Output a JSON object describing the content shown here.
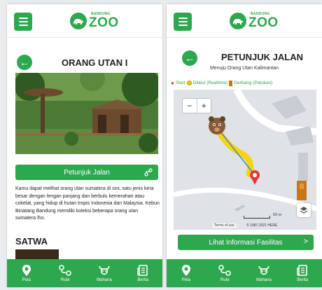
{
  "brand": {
    "small": "BANDUNG",
    "big": "ZOO",
    "green": "#2ea84f"
  },
  "left": {
    "title": "ORANG UTAN I",
    "button_label": "Petunjuk Jalan",
    "description": "Kamu dapat melihat orang utan sumatera di sini, satu jenis kera besar dengan lengan panjang dan berbulu kemerahan atau cokelat, yang hidup di hutan tropis Indonesia dan Malaysia. Kebun Binatang Bandung memiliki koleksi beberapa orang utan sumatera lho.",
    "section_title": "SATWA"
  },
  "right": {
    "title": "PETUNJUK JALAN",
    "subtitle": "Menuju Orang Utan Kalimantan",
    "legend": {
      "start": "Start",
      "realtime": "Dilalui (Realtime)",
      "gate": "Gerbang (Patokan)"
    },
    "map": {
      "zoom_out": "−",
      "zoom_in": "+",
      "scale": "50 m",
      "terms": "Terms of use",
      "copyright": "© 1987-2021 HERE",
      "watermark": "here"
    },
    "button_label": "Lihat Informasi Fasilitas",
    "button_arrow": ">"
  },
  "nav": [
    {
      "label": "Peta",
      "icon": "map-pin-icon"
    },
    {
      "label": "Rute",
      "icon": "route-icon"
    },
    {
      "label": "Wahana",
      "icon": "bull-head-icon"
    },
    {
      "label": "Berita",
      "icon": "newspaper-icon"
    }
  ]
}
